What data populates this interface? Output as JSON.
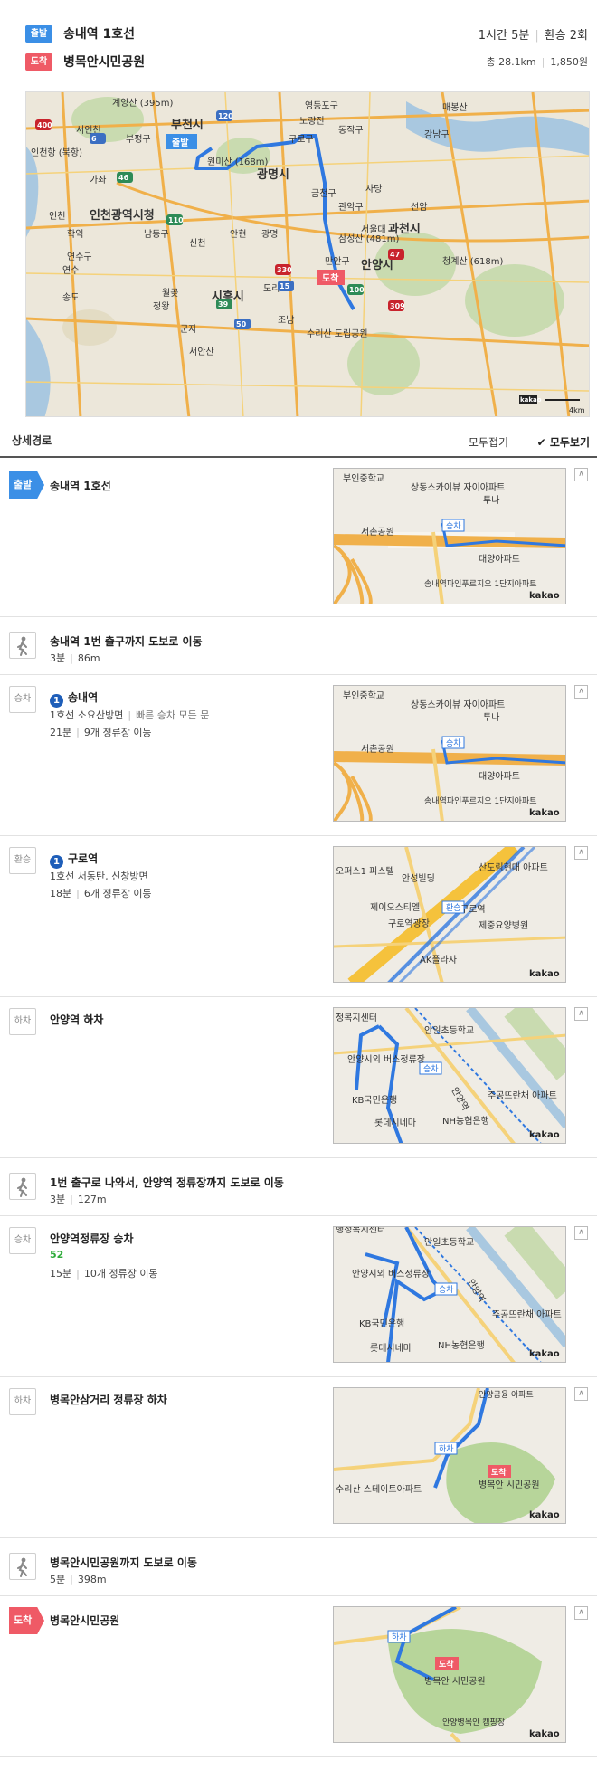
{
  "header": {
    "start_badge": "출발",
    "start_name": "송내역 1호선",
    "end_badge": "도착",
    "end_name": "병목안시민공원",
    "duration": "1시간 5분",
    "transfers": "환승 2회",
    "distance": "총 28.1km",
    "fare": "1,850원"
  },
  "main_map": {
    "labels": [
      "인천광역시청",
      "부천시",
      "광명시",
      "시흥시",
      "안양시",
      "과천시",
      "연수구",
      "영등포구",
      "동작구",
      "강남구",
      "금천구",
      "관악구",
      "구로구",
      "부평구",
      "남동구",
      "원미산 (168m)",
      "삼성산 (481m)",
      "청계산 (618m)",
      "수리산 도립공원",
      "만안구",
      "송도",
      "신천",
      "안현",
      "광명",
      "서안산",
      "인천항 (북항)",
      "계양산 (395m)",
      "서인천",
      "가좌",
      "인천",
      "학익",
      "연수",
      "정왕",
      "월곶",
      "군자",
      "도리",
      "조남",
      "매봉산",
      "사당",
      "선암",
      "서울대",
      "노량진"
    ],
    "road_numbers": [
      "400",
      "120",
      "110",
      "330",
      "15",
      "100",
      "309",
      "50",
      "39",
      "47",
      "6",
      "46"
    ],
    "start_marker": "출발",
    "end_marker": "도착",
    "logo": "kakao",
    "scale": "4km"
  },
  "detail": {
    "title": "상세경로",
    "fold_all": "모두접기",
    "show_all": "모두보기"
  },
  "steps": [
    {
      "icon": "출발",
      "title": "송내역 1호선"
    },
    {
      "icon": "walk",
      "title": "송내역 1번 출구까지 도보로 이동",
      "time": "3분",
      "dist": "86m"
    },
    {
      "icon": "승차",
      "line_num": "1",
      "title": "송내역",
      "direction": "1호선 소요산방면",
      "extra": "빠른 승차 모든 문",
      "time": "21분",
      "stops": "9개 정류장 이동"
    },
    {
      "icon": "환승",
      "line_num": "1",
      "title": "구로역",
      "direction": "1호선 서동탄, 신창방면",
      "time": "18분",
      "stops": "6개 정류장 이동"
    },
    {
      "icon": "하차",
      "title": "안양역 하차"
    },
    {
      "icon": "walk",
      "title": "1번 출구로 나와서, 안양역 정류장까지 도보로 이동",
      "time": "3분",
      "dist": "127m"
    },
    {
      "icon": "승차",
      "title": "안양역정류장 승차",
      "bus": "52",
      "time": "15분",
      "stops": "10개 정류장 이동"
    },
    {
      "icon": "하차",
      "title": "병목안삼거리 정류장 하차"
    },
    {
      "icon": "walk",
      "title": "병목안시민공원까지 도보로 이동",
      "time": "5분",
      "dist": "398m"
    },
    {
      "icon": "도착",
      "title": "병목안시민공원"
    }
  ],
  "minimaps": {
    "m1": {
      "labels": [
        "부인중학교",
        "상동스카이뷰 자이아파트",
        "투나",
        "서촌공원",
        "대양아파트",
        "송내역파인푸르지오 1단지아파트"
      ],
      "marker": "승차",
      "logo": "kakao"
    },
    "m2": {
      "labels": [
        "부인중학교",
        "상동스카이뷰 자이아파트",
        "투나",
        "서촌공원",
        "대양아파트",
        "송내역파인푸르지오 1단지아파트"
      ],
      "marker": "승차",
      "logo": "kakao"
    },
    "m3": {
      "labels": [
        "오퍼스1 피스텔",
        "안성빌딩",
        "산도림현대 아파트",
        "제이오스티엘",
        "구로역광장",
        "구로역",
        "제중요양병원",
        "AK플라자"
      ],
      "marker": "환승",
      "logo": "kakao"
    },
    "m4": {
      "labels": [
        "정복지센터",
        "안일초등학교",
        "안양시외 버스정류장",
        "안양역",
        "KB국민은행",
        "롯데시네마",
        "NH농협은행",
        "주공뜨란채 아파트"
      ],
      "marker": "승차",
      "logo": "kakao"
    },
    "m5": {
      "labels": [
        "행정복지센터",
        "안일초등학교",
        "안양시외 버스정류장",
        "안양역",
        "KB국민은행",
        "롯데시네마",
        "NH농협은행",
        "주공뜨란채 아파트"
      ],
      "marker": "승차",
      "logo": "kakao"
    },
    "m6": {
      "labels": [
        "안양금융 아파트",
        "수리산 스테이트아파트",
        "병목안 시민공원"
      ],
      "marker": "하차",
      "end": "도착",
      "logo": "kakao"
    },
    "m7": {
      "labels": [
        "병목안 시민공원",
        "안양병목안 캠핑장"
      ],
      "marker": "하차",
      "end": "도착",
      "logo": "kakao"
    }
  }
}
